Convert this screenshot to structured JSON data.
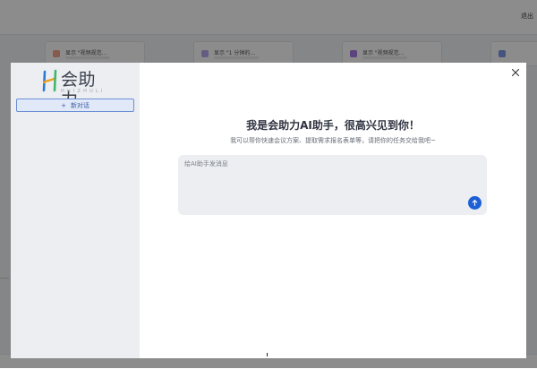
{
  "background": {
    "topbar_text": "退出",
    "cards": [
      {
        "label": "显示 \"视频规范…"
      },
      {
        "label": "显示 \"1 分钟的…"
      },
      {
        "label": "显示 \"视频规范…"
      }
    ]
  },
  "modal": {
    "logo": {
      "text": "会助力",
      "subtext": "HUIZHULI"
    },
    "new_chat_icon": "plus-icon",
    "new_chat_label": "新对话",
    "close_icon": "close-icon",
    "title": "我是会助力AI助手，很高兴见到你！",
    "subtitle": "我可以帮你快速会议方案、提取需求报名表单等，请把你的任务交给我吧~",
    "input": {
      "placeholder": "给AI助手发消息",
      "value": ""
    },
    "send_icon": "arrow-up-icon"
  },
  "colors": {
    "accent": "#1d5fd6",
    "sidebar_bg": "#eceef2",
    "input_bg": "#eceef1",
    "new_chat_border": "#6a8fd6"
  }
}
